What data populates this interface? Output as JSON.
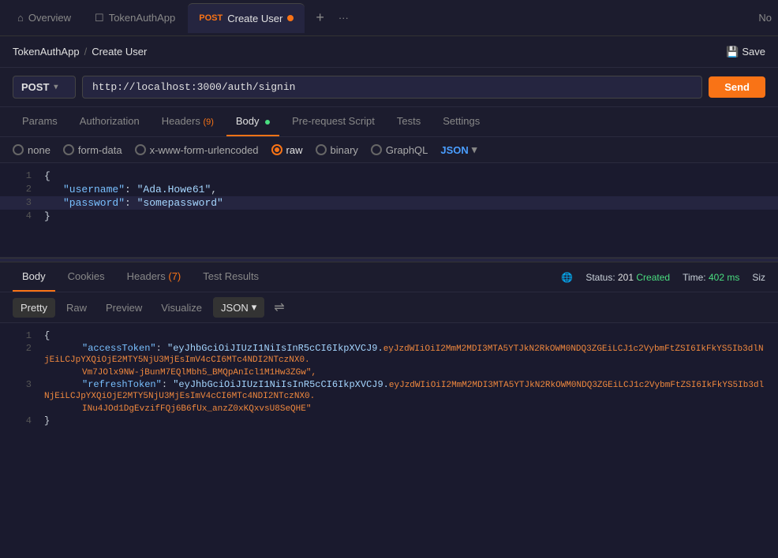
{
  "tabs": [
    {
      "id": "overview",
      "label": "Overview",
      "icon": "home",
      "active": false
    },
    {
      "id": "tokenauth",
      "label": "TokenAuthApp",
      "icon": "file",
      "active": false
    },
    {
      "id": "create-user",
      "label": "Create User",
      "method": "POST",
      "dot_color": "#f97316",
      "active": true
    }
  ],
  "tab_plus": "+",
  "tab_more": "···",
  "tab_no": "No",
  "breadcrumb": {
    "app": "TokenAuthApp",
    "separator": "/",
    "current": "Create User"
  },
  "save_label": "Save",
  "method": "POST",
  "url": "http://localhost:3000/auth/signin",
  "send_label": "Send",
  "request_tabs": [
    {
      "id": "params",
      "label": "Params",
      "active": false
    },
    {
      "id": "authorization",
      "label": "Authorization",
      "active": false
    },
    {
      "id": "headers",
      "label": "Headers",
      "badge": "9",
      "active": false
    },
    {
      "id": "body",
      "label": "Body",
      "dot": true,
      "active": true
    },
    {
      "id": "pre-request",
      "label": "Pre-request Script",
      "active": false
    },
    {
      "id": "tests",
      "label": "Tests",
      "active": false
    },
    {
      "id": "settings",
      "label": "Settings",
      "active": false
    }
  ],
  "body_types": [
    {
      "id": "none",
      "label": "none",
      "checked": false
    },
    {
      "id": "form-data",
      "label": "form-data",
      "checked": false
    },
    {
      "id": "urlencoded",
      "label": "x-www-form-urlencoded",
      "checked": false
    },
    {
      "id": "raw",
      "label": "raw",
      "checked": true
    },
    {
      "id": "binary",
      "label": "binary",
      "checked": false
    },
    {
      "id": "graphql",
      "label": "GraphQL",
      "checked": false
    }
  ],
  "json_format": "JSON",
  "request_body": {
    "lines": [
      {
        "num": 1,
        "content": "{",
        "highlighted": false
      },
      {
        "num": 2,
        "content": "    \"username\": \"Ada.Howe61\",",
        "highlighted": false
      },
      {
        "num": 3,
        "content": "    \"password\": \"somepassword\"",
        "highlighted": true
      },
      {
        "num": 4,
        "content": "}",
        "highlighted": false
      }
    ]
  },
  "response": {
    "tabs": [
      {
        "id": "body",
        "label": "Body",
        "active": true
      },
      {
        "id": "cookies",
        "label": "Cookies",
        "active": false
      },
      {
        "id": "headers",
        "label": "Headers",
        "badge": "7",
        "active": false
      },
      {
        "id": "test-results",
        "label": "Test Results",
        "active": false
      }
    ],
    "status": "201 Created",
    "status_num": "201",
    "status_text": "Created",
    "time": "402 ms",
    "time_label": "Time:",
    "size_label": "Siz",
    "format_tabs": [
      {
        "id": "pretty",
        "label": "Pretty",
        "active": true
      },
      {
        "id": "raw",
        "label": "Raw",
        "active": false
      },
      {
        "id": "preview",
        "label": "Preview",
        "active": false
      },
      {
        "id": "visualize",
        "label": "Visualize",
        "active": false
      }
    ],
    "json_label": "JSON",
    "lines": [
      {
        "num": 1,
        "content": "{"
      },
      {
        "num": 2,
        "key": "accessToken",
        "value": "eyJhbGciOiJIUzI1NiIsInR5cCI6IkpXVCJ9.eyJzdWIiOiI2MmM2MDI3MTA5YTJkN2RkOWM0NDQ3ZGEiLCJ1c2VybmFtZSI6IkFkYS5Ib3dlNjEiLCJpYXQiOjE2MTY5NjU3MjEsImV4cCI6MTc4NDI2NTczNX0.Vm7JOlx9NW-jBunM7EQlMbh5_BMQpAnIcl1M1Hw3ZGw",
        "continued": "Vm7JOlx9NW-jBunM7EQlMbh5_BMQpAnIcl1M1Hw3ZGw\","
      },
      {
        "num": 3,
        "key": "refreshToken",
        "value": "eyJhbGciOiJIUzI1NiIsInR5cCI6IkpXVCJ9.eyJzdWIiOiI2MmM2MDI3MTA5YTJkN2RkOWM0NDQ3ZGEiLCJ1c2VybmFtZSI6IkFkYS5Ib3dlNjEiLCJpYXQiOjE2MTY5NjU3MjEsImV4cCI6MTc4NDI2NTczNX0.INu4JOd1DgEvzifFQj6B6fUx_anzZ0xKQxvsU8SeQHE",
        "continued": "INu4JOd1DgEvzifFQj6B6fUx_anzZ0xKQxvsU8SeQHE\""
      },
      {
        "num": 4,
        "content": "}"
      }
    ],
    "line2_token1": "\"eyJhbGciOiJIUzI1NiIsInR5cCI6IkpXVCJ9.",
    "line2_token2": "eyJzdWIiOiI2MmM2MDI3MTA5YTJkN2RkOWM0NDQ3ZGEiLCJ1c2VybmFtZSI6IkFkYS5Ib3dlNjEiLCJpYXQiOjE2MTY5NjU3MjEsImV4cCI6MTc4NDI2NTczNX0.",
    "line2_token3": "Vm7JOlx9NW-jBunM7EQlMbh5_BMQpAnIcl1M1Hw32Gw\","
  }
}
